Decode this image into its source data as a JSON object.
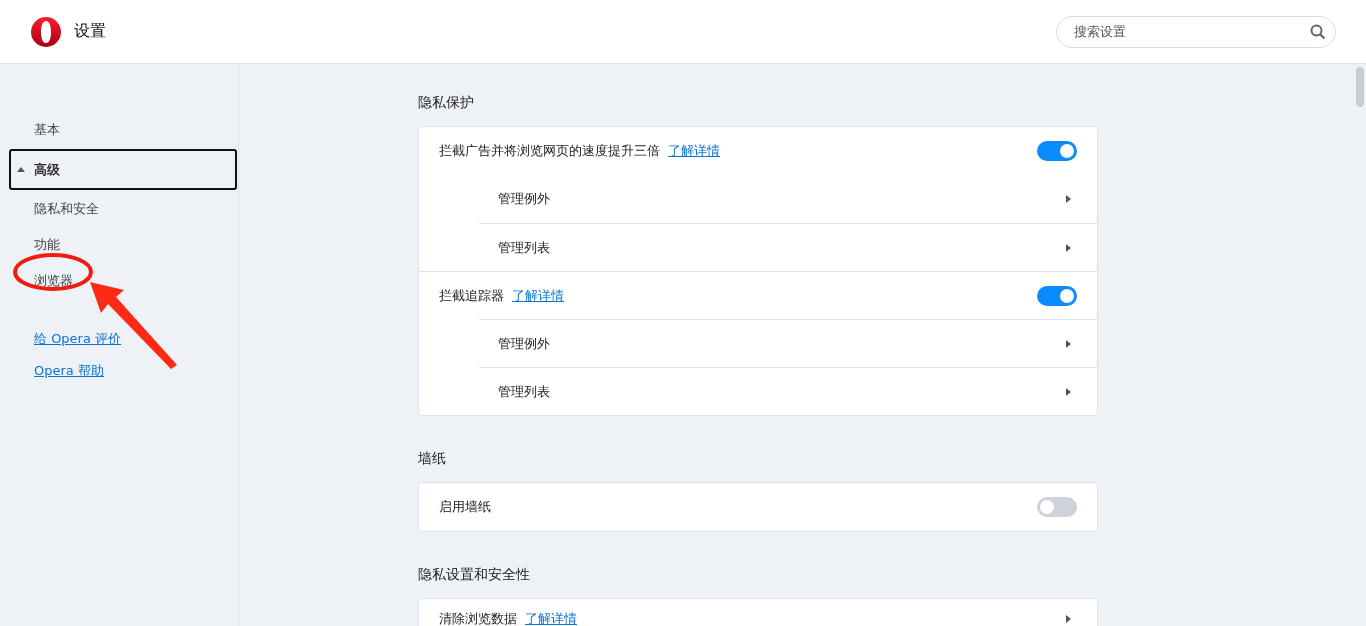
{
  "header": {
    "title": "设置",
    "search": {
      "placeholder": "搜索设置"
    }
  },
  "sidebar": {
    "items": [
      {
        "kind": "item",
        "label": "基本",
        "selected": false
      },
      {
        "kind": "group",
        "label": "高级",
        "selected": true,
        "expanded": true
      },
      {
        "kind": "item",
        "label": "隐私和安全",
        "selected": false
      },
      {
        "kind": "item",
        "label": "功能",
        "selected": false
      },
      {
        "kind": "item",
        "label": "浏览器",
        "selected": false
      }
    ],
    "links": [
      "给 Opera 评价",
      "Opera 帮助"
    ]
  },
  "sections": [
    {
      "title": "隐私保护",
      "rows": [
        {
          "kind": "toggle",
          "label": "拦截广告并将浏览网页的速度提升三倍",
          "link": "了解详情",
          "on": true
        },
        {
          "kind": "sub",
          "label": "管理例外"
        },
        {
          "kind": "sub",
          "label": "管理列表"
        },
        {
          "kind": "toggle",
          "label": "拦截追踪器",
          "link": "了解详情",
          "on": true
        },
        {
          "kind": "sub",
          "label": "管理例外"
        },
        {
          "kind": "sub",
          "label": "管理列表"
        }
      ]
    },
    {
      "title": "墙纸",
      "rows": [
        {
          "kind": "toggle",
          "label": "启用墙纸",
          "on": false
        }
      ]
    },
    {
      "title": "隐私设置和安全性",
      "rows": [
        {
          "kind": "nav",
          "label": "清除浏览数据",
          "link": "了解详情"
        }
      ]
    }
  ]
}
